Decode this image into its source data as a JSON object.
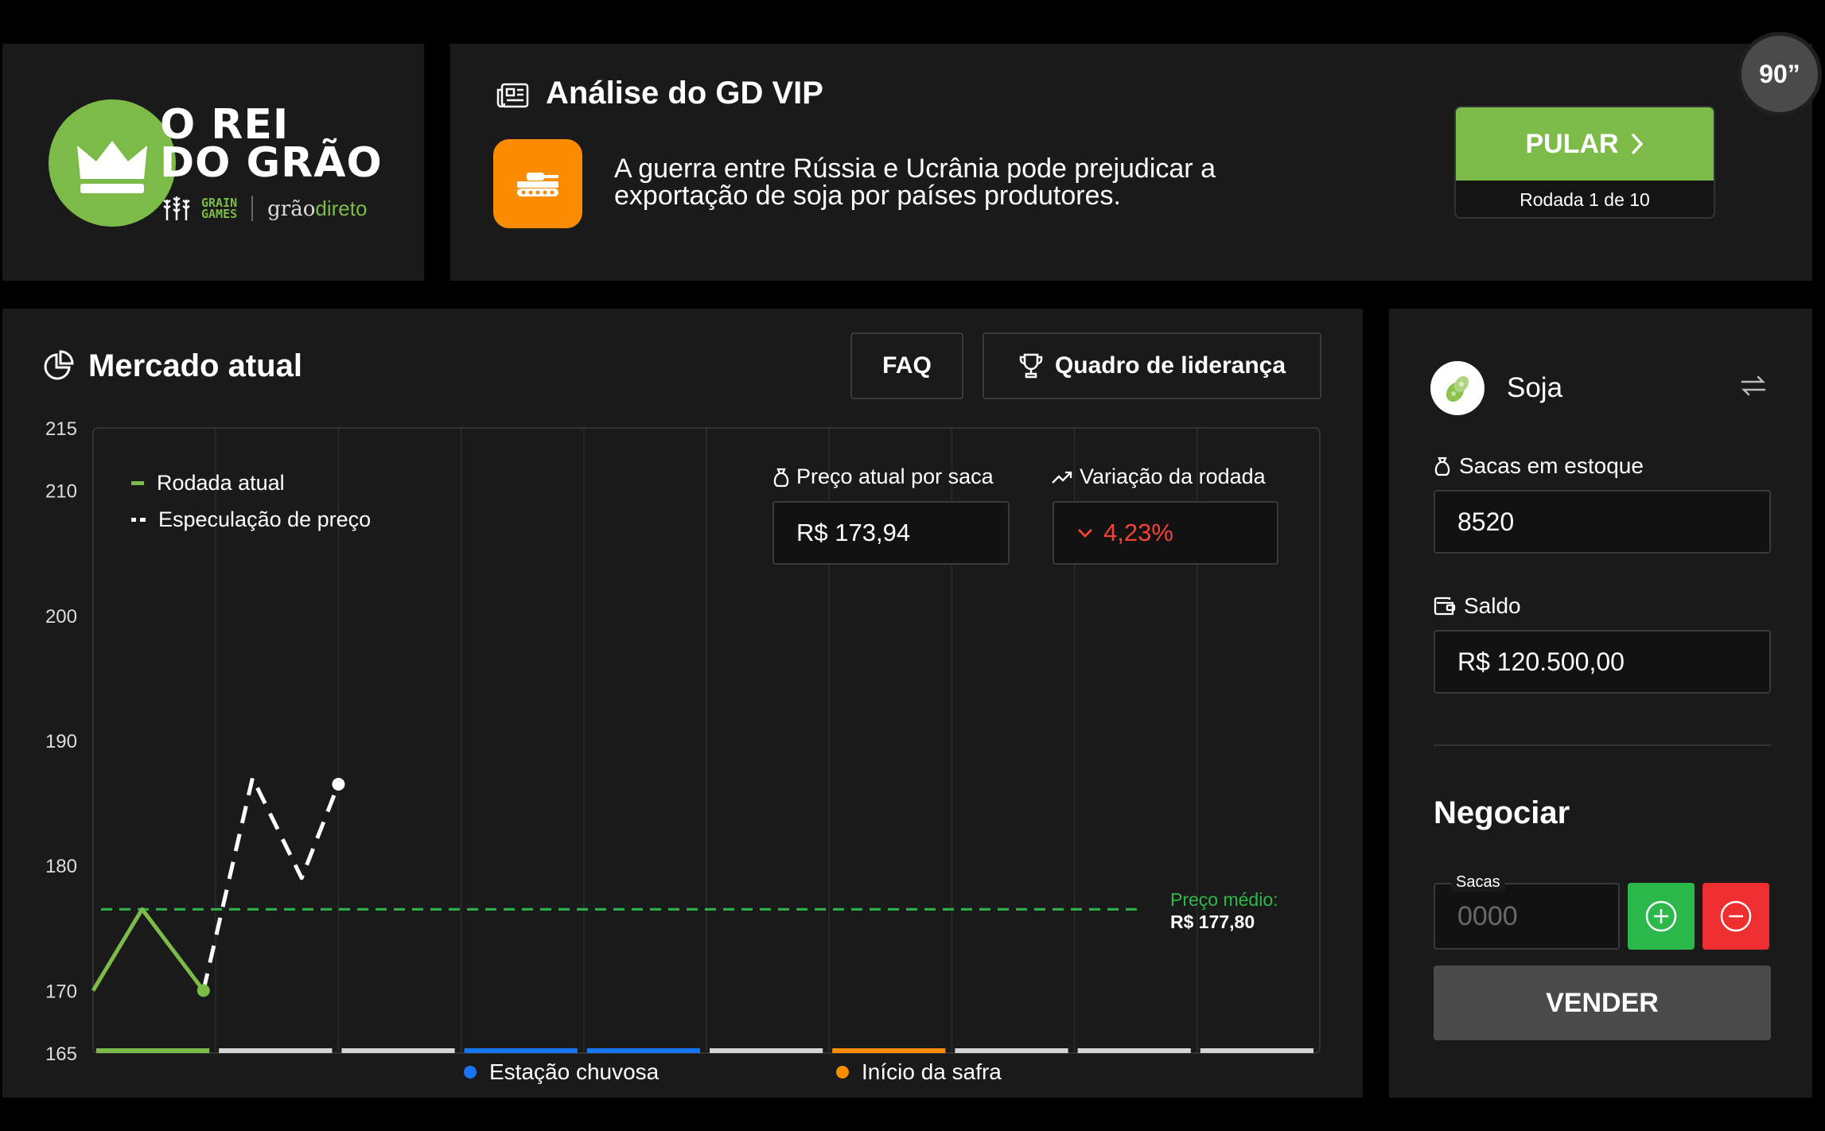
{
  "brand": {
    "title_line1": "O REI",
    "title_line2": "DO GRÃO",
    "partner1_line1": "GRAIN",
    "partner1_line2": "GAMES",
    "partner2_part1": "grão",
    "partner2_part2": "direto"
  },
  "news": {
    "title": "Análise do GD VIP",
    "text": "A guerra entre Rússia e Ucrânia pode prejudicar a exportação de soja por países produtores.",
    "skip_label": "PULAR",
    "round_label": "Rodada 1 de 10"
  },
  "timer": {
    "label": "90”"
  },
  "market": {
    "title": "Mercado atual",
    "faq_label": "FAQ",
    "leaderboard_label": "Quadro de liderança",
    "legend_current": "Rodada atual",
    "legend_speculation": "Especulação de preço",
    "price_label": "Preço atual por saca",
    "price_value": "R$ 173,94",
    "variation_label": "Variação da rodada",
    "variation_value": "4,23%",
    "avg_label": "Preço médio:",
    "avg_value": "R$ 177,80",
    "event_rainy": "Estação chuvosa",
    "event_harvest": "Início da safra"
  },
  "trade": {
    "commodity": "Soja",
    "stock_label": "Sacas em estoque",
    "stock_value": "8520",
    "balance_label": "Saldo",
    "balance_value": "R$ 120.500,00",
    "negotiate_title": "Negociar",
    "qty_label": "Sacas",
    "qty_placeholder": "0000",
    "sell_label": "VENDER"
  },
  "colors": {
    "accent_green": "#7dbb48",
    "alert_orange": "#fb8c00",
    "event_blue": "#1976f2",
    "negative_red": "#f44336",
    "plus_green": "#2db84c",
    "minus_red": "#ef2f2f"
  },
  "chart_data": {
    "type": "line",
    "ylim": [
      165,
      215
    ],
    "yticks": [
      165,
      170,
      180,
      190,
      200,
      210,
      215
    ],
    "rounds": 10,
    "series": [
      {
        "name": "Rodada atual",
        "x": [
          0,
          0.4,
          0.9
        ],
        "values": [
          170,
          176.5,
          170
        ],
        "style": "solid"
      },
      {
        "name": "Especulação de preço",
        "x": [
          0.9,
          1.3,
          1.7,
          2.0
        ],
        "values": [
          170,
          187,
          179,
          186.5
        ],
        "style": "dashed"
      }
    ],
    "reference_lines": [
      {
        "label": "Preço médio:",
        "value": 176.5
      }
    ],
    "round_bars": [
      "current",
      "default",
      "default",
      "rainy",
      "rainy",
      "default",
      "harvest",
      "default",
      "default",
      "default"
    ],
    "events": [
      "Estação chuvosa",
      "Início da safra"
    ]
  }
}
